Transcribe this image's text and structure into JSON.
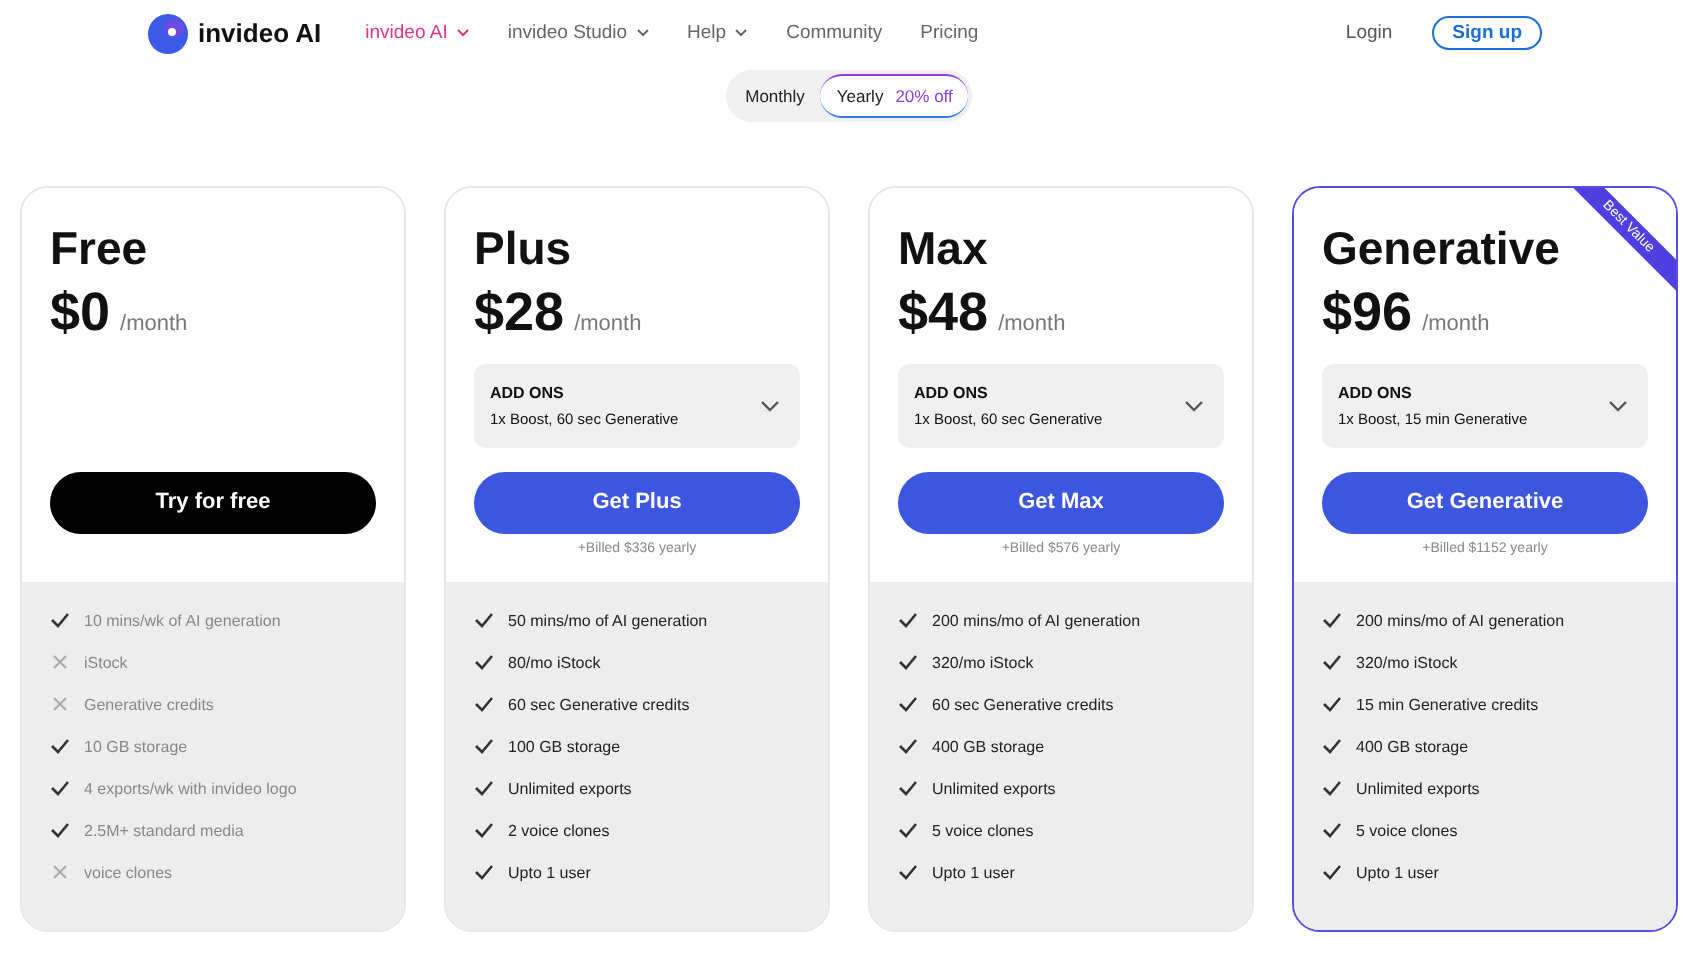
{
  "brand": {
    "name": "invideo AI"
  },
  "nav": [
    {
      "label": "invideo AI",
      "selected": true,
      "dropdown": true
    },
    {
      "label": "invideo Studio",
      "selected": false,
      "dropdown": true
    },
    {
      "label": "Help",
      "selected": false,
      "dropdown": true
    },
    {
      "label": "Community",
      "selected": false,
      "dropdown": false
    },
    {
      "label": "Pricing",
      "selected": false,
      "dropdown": false
    }
  ],
  "login": "Login",
  "signup": "Sign up",
  "billing_toggle": [
    {
      "label": "Monthly",
      "selected": false
    },
    {
      "label": "Yearly",
      "selected": true,
      "badge": "20% off"
    }
  ],
  "plans": [
    {
      "name": "Free",
      "price": "$0",
      "period": "/month",
      "button": "Try for free",
      "kind": "dark",
      "muted": true,
      "highlighted": false,
      "features": [
        {
          "text": "10 mins/wk of AI generation",
          "included": true
        },
        {
          "text": "iStock",
          "included": false
        },
        {
          "text": "Generative credits",
          "included": false
        },
        {
          "text": "10 GB storage",
          "included": true
        },
        {
          "text": "4 exports/wk with invideo logo",
          "included": true
        },
        {
          "text": "2.5M+ standard media",
          "included": true
        },
        {
          "text": "voice clones",
          "included": false
        }
      ]
    },
    {
      "name": "Plus",
      "price": "$28",
      "period": "/month",
      "addons": {
        "label": "ADD ONS",
        "value": "1x Boost, 60 sec Generative"
      },
      "button": "Get Plus",
      "kind": "primary",
      "billed": "+Billed $336 yearly",
      "muted": false,
      "highlighted": false,
      "features": [
        {
          "text": "50 mins/mo of AI generation",
          "included": true
        },
        {
          "text": "80/mo iStock",
          "included": true
        },
        {
          "text": "60 sec Generative credits",
          "included": true
        },
        {
          "text": "100 GB storage",
          "included": true
        },
        {
          "text": "Unlimited exports",
          "included": true
        },
        {
          "text": "2 voice clones",
          "included": true
        },
        {
          "text": "Upto 1 user",
          "included": true
        }
      ]
    },
    {
      "name": "Max",
      "price": "$48",
      "period": "/month",
      "addons": {
        "label": "ADD ONS",
        "value": "1x Boost, 60 sec Generative"
      },
      "button": "Get Max",
      "kind": "primary",
      "billed": "+Billed $576 yearly",
      "muted": false,
      "highlighted": false,
      "features": [
        {
          "text": "200 mins/mo of AI generation",
          "included": true
        },
        {
          "text": "320/mo iStock",
          "included": true
        },
        {
          "text": "60 sec Generative credits",
          "included": true
        },
        {
          "text": "400 GB storage",
          "included": true
        },
        {
          "text": "Unlimited exports",
          "included": true
        },
        {
          "text": "5 voice clones",
          "included": true
        },
        {
          "text": "Upto 1 user",
          "included": true
        }
      ]
    },
    {
      "name": "Generative",
      "price": "$96",
      "period": "/month",
      "addons": {
        "label": "ADD ONS",
        "value": "1x Boost, 15 min Generative"
      },
      "button": "Get Generative",
      "kind": "primary",
      "billed": "+Billed $1152 yearly",
      "muted": false,
      "highlighted": true,
      "ribbon": "Best Value",
      "features": [
        {
          "text": "200 mins/mo of AI generation",
          "included": true
        },
        {
          "text": "320/mo iStock",
          "included": true
        },
        {
          "text": "15 min Generative credits",
          "included": true
        },
        {
          "text": "400 GB storage",
          "included": true
        },
        {
          "text": "Unlimited exports",
          "included": true
        },
        {
          "text": "5 voice clones",
          "included": true
        },
        {
          "text": "Upto 1 user",
          "included": true
        }
      ]
    }
  ]
}
